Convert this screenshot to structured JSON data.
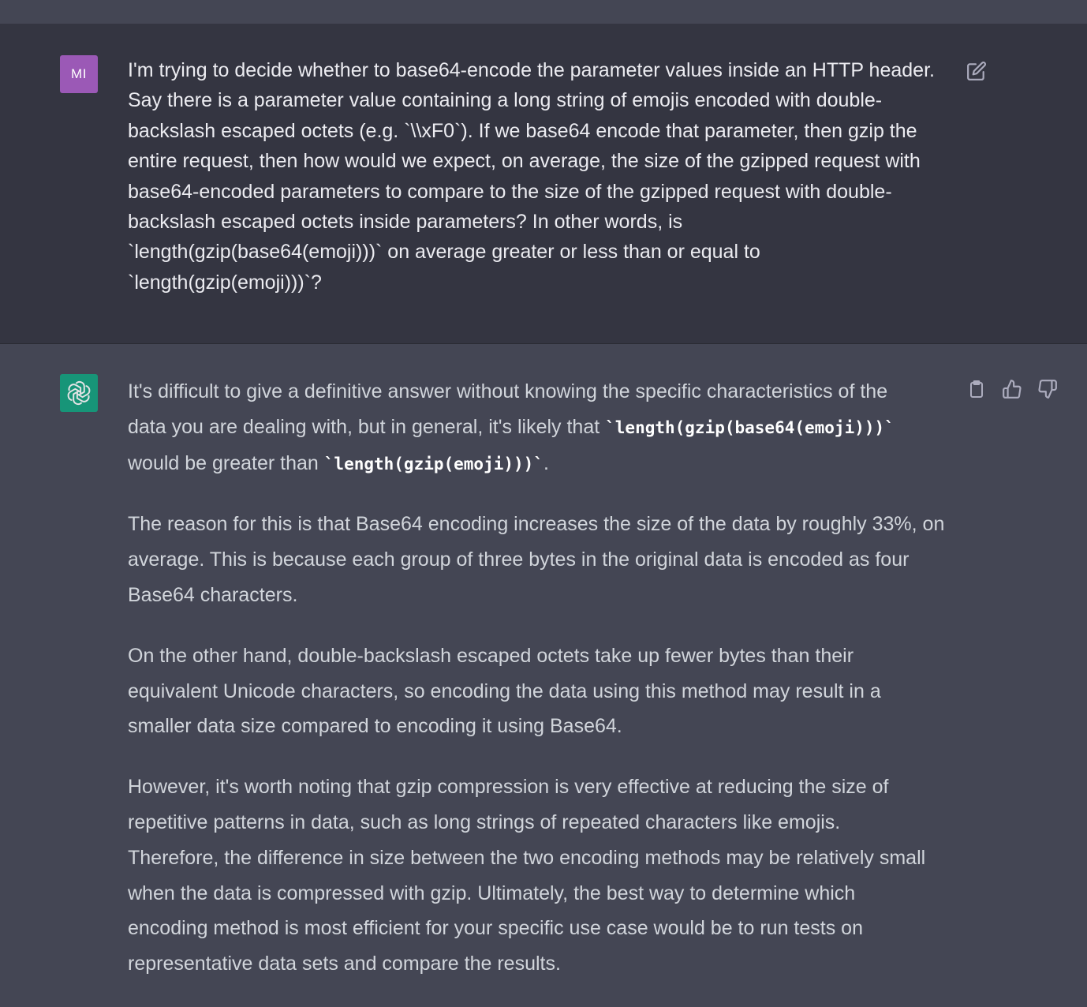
{
  "user": {
    "avatar_initials": "MI",
    "message_lines": [
      "I'm trying to decide whether to base64-encode the parameter values inside an HTTP header.",
      "Say there is a parameter value containing a long string of emojis encoded with double-",
      "backslash escaped octets (e.g. `\\\\xF0`). If we base64 encode that parameter, then gzip the",
      "entire request, then how would we expect, on average, the size of the gzipped request with",
      "base64-encoded parameters to compare to the size of the gzipped request with double-",
      "backslash escaped octets inside parameters? In other words, is",
      "`length(gzip(base64(emoji)))` on average greater or less than or equal to",
      "`length(gzip(emoji)))`?"
    ]
  },
  "assistant": {
    "p1": {
      "line1": "It's difficult to give a definitive answer without knowing the specific characteristics of the",
      "line2_prefix": "data you are dealing with, but in general, it's likely that ",
      "code1": "`length(gzip(base64(emoji)))`",
      "line3_prefix": "would be greater than ",
      "code2": "`length(gzip(emoji)))`",
      "line3_suffix": "."
    },
    "p2": [
      "The reason for this is that Base64 encoding increases the size of the data by roughly 33%, on",
      "average. This is because each group of three bytes in the original data is encoded as four",
      "Base64 characters."
    ],
    "p3": [
      "On the other hand, double-backslash escaped octets take up fewer bytes than their",
      "equivalent Unicode characters, so encoding the data using this method may result in a",
      "smaller data size compared to encoding it using Base64."
    ],
    "p4": [
      "However, it's worth noting that gzip compression is very effective at reducing the size of",
      "repetitive patterns in data, such as long strings of repeated characters like emojis.",
      "Therefore, the difference in size between the two encoding methods may be relatively small",
      "when the data is compressed with gzip. Ultimately, the best way to determine which",
      "encoding method is most efficient for your specific use case would be to run tests on",
      "representative data sets and compare the results."
    ]
  },
  "icons": {
    "edit": "edit-icon",
    "copy": "clipboard-icon",
    "like": "thumbs-up-icon",
    "dislike": "thumbs-down-icon",
    "bot_logo": "openai-logo-icon"
  },
  "colors": {
    "user_bg": "#343541",
    "assistant_bg": "#444654",
    "user_avatar": "#9b59b6",
    "bot_avatar": "#10a37f"
  }
}
